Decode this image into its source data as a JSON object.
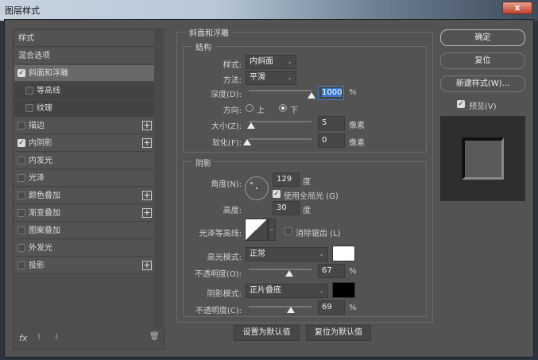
{
  "window": {
    "title": "图层样式",
    "close": "x"
  },
  "sidebar": {
    "items": [
      {
        "label": "样式",
        "checked": null,
        "plus": false
      },
      {
        "label": "混合选项",
        "checked": null,
        "plus": false
      },
      {
        "label": "斜面和浮雕",
        "checked": true,
        "plus": false,
        "selected": true
      },
      {
        "label": "等高线",
        "checked": false,
        "plus": false,
        "sub": true
      },
      {
        "label": "纹理",
        "checked": false,
        "plus": false,
        "sub": true
      },
      {
        "label": "描边",
        "checked": false,
        "plus": true
      },
      {
        "label": "内阴影",
        "checked": true,
        "plus": true
      },
      {
        "label": "内发光",
        "checked": false,
        "plus": false
      },
      {
        "label": "光泽",
        "checked": false,
        "plus": false
      },
      {
        "label": "颜色叠加",
        "checked": false,
        "plus": true
      },
      {
        "label": "渐变叠加",
        "checked": false,
        "plus": true
      },
      {
        "label": "图案叠加",
        "checked": false,
        "plus": false
      },
      {
        "label": "外发光",
        "checked": false,
        "plus": false
      },
      {
        "label": "投影",
        "checked": false,
        "plus": true
      }
    ],
    "fx": "fx"
  },
  "bevel": {
    "title": "斜面和浮雕",
    "structure": {
      "title": "结构",
      "style_label": "样式:",
      "style_value": "内斜面",
      "method_label": "方法:",
      "method_value": "平滑",
      "depth_label": "深度(D):",
      "depth_value": "1000",
      "depth_unit": "%",
      "direction_label": "方向:",
      "dir_up": "上",
      "dir_down": "下",
      "direction": "下",
      "size_label": "大小(Z):",
      "size_value": "5",
      "size_unit": "像素",
      "soften_label": "软化(F):",
      "soften_value": "0",
      "soften_unit": "像素"
    },
    "shading": {
      "title": "阴影",
      "angle_label": "角度(N):",
      "angle_value": "129",
      "angle_unit": "度",
      "global_light": "使用全局光 (G)",
      "altitude_label": "高度:",
      "altitude_value": "30",
      "altitude_unit": "度",
      "gloss_label": "光泽等高线:",
      "antialias": "消除锯齿 (L)",
      "highlight_label": "高光模式:",
      "highlight_mode": "正常",
      "highlight_color": "#ffffff",
      "hl_opacity_label": "不透明度(O):",
      "hl_opacity": "67",
      "hl_unit": "%",
      "shadow_label": "阴影模式:",
      "shadow_mode": "正片叠底",
      "shadow_color": "#000000",
      "sh_opacity_label": "不透明度(C):",
      "sh_opacity": "69",
      "sh_unit": "%"
    },
    "set_default": "设置为默认值",
    "reset_default": "复位为默认值"
  },
  "actions": {
    "ok": "确定",
    "reset": "复位",
    "new_style": "新建样式(W)...",
    "preview": "预览(V)"
  }
}
